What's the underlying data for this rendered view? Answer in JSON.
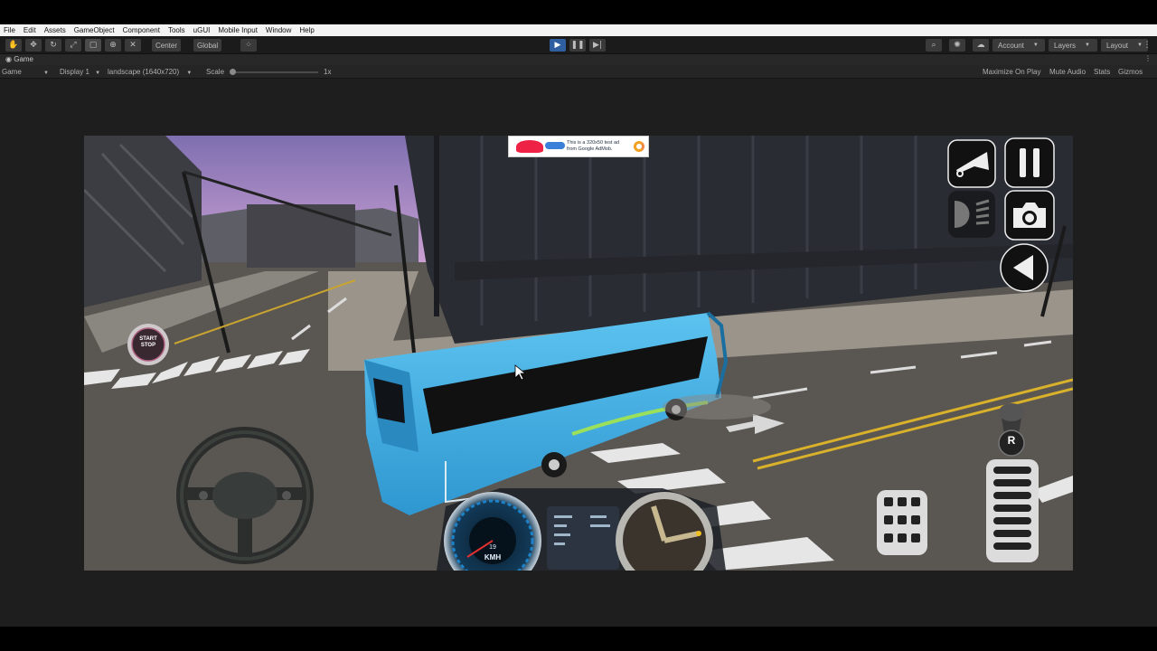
{
  "menu": [
    "File",
    "Edit",
    "Assets",
    "GameObject",
    "Component",
    "Tools",
    "uGUI",
    "Mobile Input",
    "Window",
    "Help"
  ],
  "toolbar": {
    "center_label": "Center",
    "global_label": "Global",
    "account_label": "Account",
    "layers_label": "Layers",
    "layout_label": "Layout"
  },
  "game_tab": {
    "label": "Game"
  },
  "game_bar": {
    "view_select": "Game",
    "display_select": "Display 1",
    "resolution_select": "landscape (1640x720)",
    "scale_label": "Scale",
    "scale_value": "1x",
    "maximize_on_play": "Maximize On Play",
    "mute_audio": "Mute Audio",
    "stats": "Stats",
    "gizmos": "Gizmos"
  },
  "game": {
    "ad_text": "This is a 320x50 test ad from Google AdMob.",
    "start_stop_label": "START\nSTOP",
    "speed_value": "19",
    "speed_unit": "KMH",
    "gear_label": "R",
    "icons": [
      "horn-icon",
      "pause-icon",
      "headlight-icon",
      "camera-icon",
      "back-arrow-icon",
      "steering-wheel-icon",
      "brake-pedal-icon",
      "accelerator-pedal-icon"
    ]
  },
  "colors": {
    "bus_body": "#3aa8e0",
    "sky_top": "#7e6fb0",
    "sky_bottom": "#d6a7d8",
    "road": "#5a5652",
    "editor_bg": "#1e1e1e",
    "play_accent": "#2f5fa0"
  }
}
